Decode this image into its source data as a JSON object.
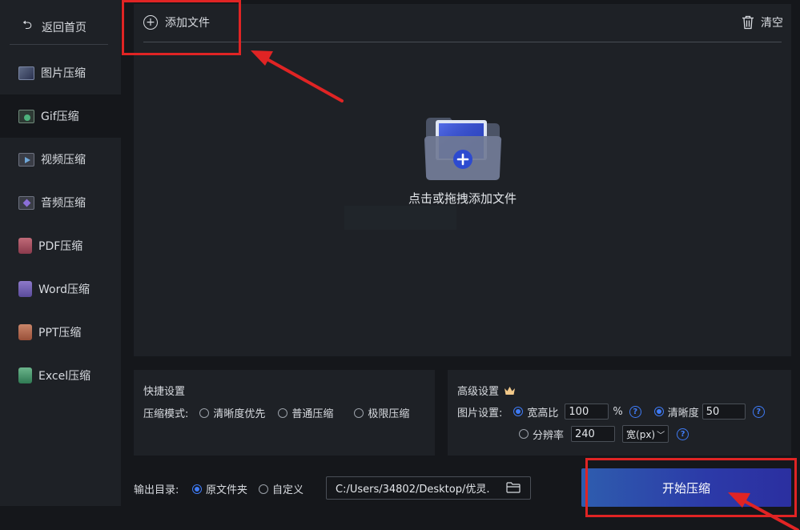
{
  "sidebar": {
    "back_label": "返回首页",
    "items": [
      {
        "label": "图片压缩",
        "icon": "image-compress-icon"
      },
      {
        "label": "Gif压缩",
        "icon": "gif-compress-icon",
        "active": true
      },
      {
        "label": "视频压缩",
        "icon": "video-compress-icon"
      },
      {
        "label": "音频压缩",
        "icon": "audio-compress-icon"
      },
      {
        "label": "PDF压缩",
        "icon": "pdf-compress-icon"
      },
      {
        "label": "Word压缩",
        "icon": "word-compress-icon"
      },
      {
        "label": "PPT压缩",
        "icon": "ppt-compress-icon"
      },
      {
        "label": "Excel压缩",
        "icon": "excel-compress-icon"
      }
    ]
  },
  "toolbar": {
    "add_label": "添加文件",
    "clear_label": "清空"
  },
  "dropzone": {
    "hint": "点击或拖拽添加文件"
  },
  "quick": {
    "title": "快捷设置",
    "mode_label": "压缩模式:",
    "options": [
      "清晰度优先",
      "普通压缩",
      "极限压缩"
    ]
  },
  "advanced": {
    "title": "高级设置",
    "image_label": "图片设置:",
    "aspect_label": "宽高比",
    "aspect_value": "100",
    "percent": "%",
    "clarity_label": "清晰度",
    "clarity_value": "50",
    "resolution_label": "分辨率",
    "resolution_value": "240",
    "unit_value": "宽(px)",
    "help": "?"
  },
  "output": {
    "label": "输出目录:",
    "option_original": "原文件夹",
    "option_custom": "自定义",
    "path": "C:/Users/34802/Desktop/优灵."
  },
  "start_label": "开始压缩",
  "colors": {
    "accent": "#3f7bf5",
    "highlight": "#e02424",
    "button_start": "#2e5dae",
    "button_end": "#2b2fa0"
  }
}
